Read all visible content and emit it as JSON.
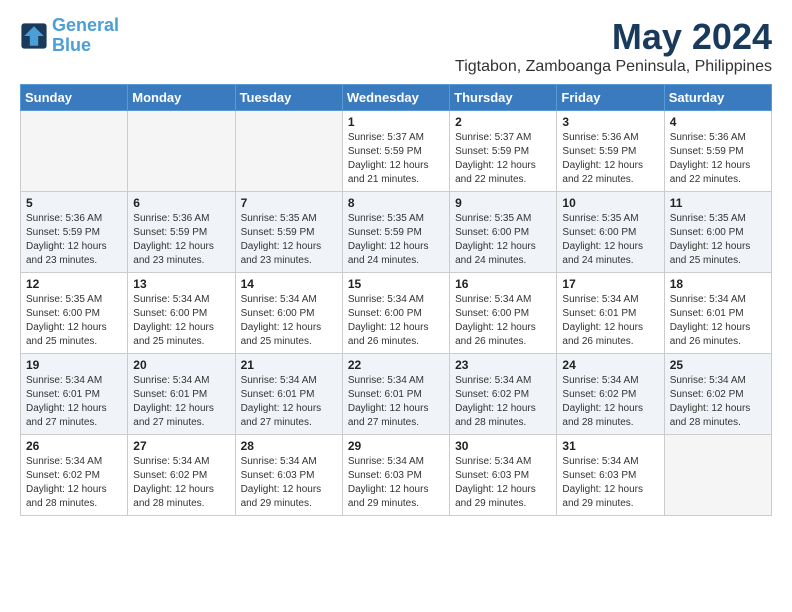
{
  "header": {
    "logo_line1": "General",
    "logo_line2": "Blue",
    "month": "May 2024",
    "location": "Tigtabon, Zamboanga Peninsula, Philippines"
  },
  "days_of_week": [
    "Sunday",
    "Monday",
    "Tuesday",
    "Wednesday",
    "Thursday",
    "Friday",
    "Saturday"
  ],
  "weeks": [
    [
      {
        "day": "",
        "info": ""
      },
      {
        "day": "",
        "info": ""
      },
      {
        "day": "",
        "info": ""
      },
      {
        "day": "1",
        "info": "Sunrise: 5:37 AM\nSunset: 5:59 PM\nDaylight: 12 hours\nand 21 minutes."
      },
      {
        "day": "2",
        "info": "Sunrise: 5:37 AM\nSunset: 5:59 PM\nDaylight: 12 hours\nand 22 minutes."
      },
      {
        "day": "3",
        "info": "Sunrise: 5:36 AM\nSunset: 5:59 PM\nDaylight: 12 hours\nand 22 minutes."
      },
      {
        "day": "4",
        "info": "Sunrise: 5:36 AM\nSunset: 5:59 PM\nDaylight: 12 hours\nand 22 minutes."
      }
    ],
    [
      {
        "day": "5",
        "info": "Sunrise: 5:36 AM\nSunset: 5:59 PM\nDaylight: 12 hours\nand 23 minutes."
      },
      {
        "day": "6",
        "info": "Sunrise: 5:36 AM\nSunset: 5:59 PM\nDaylight: 12 hours\nand 23 minutes."
      },
      {
        "day": "7",
        "info": "Sunrise: 5:35 AM\nSunset: 5:59 PM\nDaylight: 12 hours\nand 23 minutes."
      },
      {
        "day": "8",
        "info": "Sunrise: 5:35 AM\nSunset: 5:59 PM\nDaylight: 12 hours\nand 24 minutes."
      },
      {
        "day": "9",
        "info": "Sunrise: 5:35 AM\nSunset: 6:00 PM\nDaylight: 12 hours\nand 24 minutes."
      },
      {
        "day": "10",
        "info": "Sunrise: 5:35 AM\nSunset: 6:00 PM\nDaylight: 12 hours\nand 24 minutes."
      },
      {
        "day": "11",
        "info": "Sunrise: 5:35 AM\nSunset: 6:00 PM\nDaylight: 12 hours\nand 25 minutes."
      }
    ],
    [
      {
        "day": "12",
        "info": "Sunrise: 5:35 AM\nSunset: 6:00 PM\nDaylight: 12 hours\nand 25 minutes."
      },
      {
        "day": "13",
        "info": "Sunrise: 5:34 AM\nSunset: 6:00 PM\nDaylight: 12 hours\nand 25 minutes."
      },
      {
        "day": "14",
        "info": "Sunrise: 5:34 AM\nSunset: 6:00 PM\nDaylight: 12 hours\nand 25 minutes."
      },
      {
        "day": "15",
        "info": "Sunrise: 5:34 AM\nSunset: 6:00 PM\nDaylight: 12 hours\nand 26 minutes."
      },
      {
        "day": "16",
        "info": "Sunrise: 5:34 AM\nSunset: 6:00 PM\nDaylight: 12 hours\nand 26 minutes."
      },
      {
        "day": "17",
        "info": "Sunrise: 5:34 AM\nSunset: 6:01 PM\nDaylight: 12 hours\nand 26 minutes."
      },
      {
        "day": "18",
        "info": "Sunrise: 5:34 AM\nSunset: 6:01 PM\nDaylight: 12 hours\nand 26 minutes."
      }
    ],
    [
      {
        "day": "19",
        "info": "Sunrise: 5:34 AM\nSunset: 6:01 PM\nDaylight: 12 hours\nand 27 minutes."
      },
      {
        "day": "20",
        "info": "Sunrise: 5:34 AM\nSunset: 6:01 PM\nDaylight: 12 hours\nand 27 minutes."
      },
      {
        "day": "21",
        "info": "Sunrise: 5:34 AM\nSunset: 6:01 PM\nDaylight: 12 hours\nand 27 minutes."
      },
      {
        "day": "22",
        "info": "Sunrise: 5:34 AM\nSunset: 6:01 PM\nDaylight: 12 hours\nand 27 minutes."
      },
      {
        "day": "23",
        "info": "Sunrise: 5:34 AM\nSunset: 6:02 PM\nDaylight: 12 hours\nand 28 minutes."
      },
      {
        "day": "24",
        "info": "Sunrise: 5:34 AM\nSunset: 6:02 PM\nDaylight: 12 hours\nand 28 minutes."
      },
      {
        "day": "25",
        "info": "Sunrise: 5:34 AM\nSunset: 6:02 PM\nDaylight: 12 hours\nand 28 minutes."
      }
    ],
    [
      {
        "day": "26",
        "info": "Sunrise: 5:34 AM\nSunset: 6:02 PM\nDaylight: 12 hours\nand 28 minutes."
      },
      {
        "day": "27",
        "info": "Sunrise: 5:34 AM\nSunset: 6:02 PM\nDaylight: 12 hours\nand 28 minutes."
      },
      {
        "day": "28",
        "info": "Sunrise: 5:34 AM\nSunset: 6:03 PM\nDaylight: 12 hours\nand 29 minutes."
      },
      {
        "day": "29",
        "info": "Sunrise: 5:34 AM\nSunset: 6:03 PM\nDaylight: 12 hours\nand 29 minutes."
      },
      {
        "day": "30",
        "info": "Sunrise: 5:34 AM\nSunset: 6:03 PM\nDaylight: 12 hours\nand 29 minutes."
      },
      {
        "day": "31",
        "info": "Sunrise: 5:34 AM\nSunset: 6:03 PM\nDaylight: 12 hours\nand 29 minutes."
      },
      {
        "day": "",
        "info": ""
      }
    ]
  ]
}
